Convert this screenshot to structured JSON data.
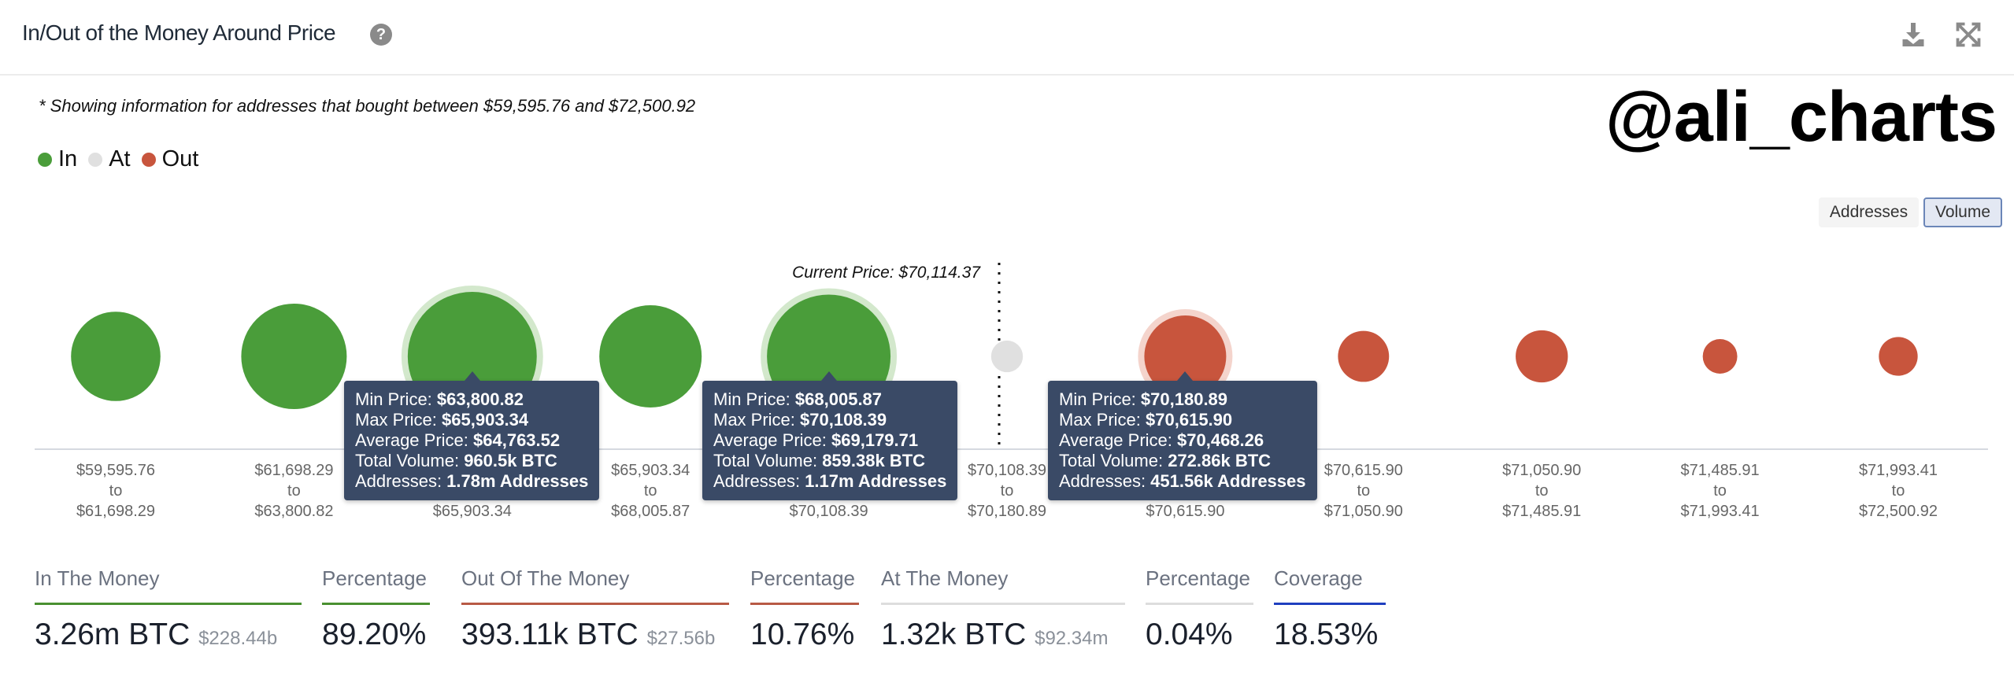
{
  "header": {
    "title": "In/Out of the Money Around Price",
    "help_icon": "question-circle-icon",
    "download_icon": "download-icon",
    "expand_icon": "expand-icon"
  },
  "subtitle": "* Showing information for addresses that bought between $59,595.76 and $72,500.92",
  "brand": "@ali_charts",
  "legend": [
    {
      "label": "In",
      "color": "#4a9d3a"
    },
    {
      "label": "At",
      "color": "#e0e0e0"
    },
    {
      "label": "Out",
      "color": "#c8553d"
    }
  ],
  "toggle": {
    "addresses": "Addresses",
    "volume": "Volume",
    "selected": "Volume"
  },
  "chart_data": {
    "type": "bubble",
    "current_price_label": "Current Price: $70,114.37",
    "current_price": 70114.37,
    "metric": "Volume (BTC, thousands; estimated from bubble size except where tooltip shows)",
    "bins": [
      {
        "from": "$59,595.76",
        "to": "$61,698.29",
        "status": "in",
        "volume_k": 355
      },
      {
        "from": "$61,698.29",
        "to": "$63,800.82",
        "status": "in",
        "volume_k": 565
      },
      {
        "from": "$63,800.82",
        "to": "$65,903.34",
        "status": "in",
        "volume_k": 960.5,
        "highlight": true
      },
      {
        "from": "$65,903.34",
        "to": "$68,005.87",
        "status": "in",
        "volume_k": 520
      },
      {
        "from": "$68,005.87",
        "to": "$70,108.39",
        "status": "in",
        "volume_k": 859.38,
        "highlight": true
      },
      {
        "from": "$70,108.39",
        "to": "$70,180.89",
        "status": "at",
        "volume_k": 1.32
      },
      {
        "from": "$70,180.89",
        "to": "$70,615.90",
        "status": "out",
        "volume_k": 272.86,
        "highlight": true
      },
      {
        "from": "$70,615.90",
        "to": "$71,050.90",
        "status": "out",
        "volume_k": 50
      },
      {
        "from": "$71,050.90",
        "to": "$71,485.91",
        "status": "out",
        "volume_k": 55
      },
      {
        "from": "$71,485.91",
        "to": "$71,993.41",
        "status": "out",
        "volume_k": 4
      },
      {
        "from": "$71,993.41",
        "to": "$72,500.92",
        "status": "out",
        "volume_k": 11
      }
    ],
    "to_word": "to",
    "colors": {
      "in": "#4a9d3a",
      "at": "#e0e0e0",
      "out": "#c8553d",
      "in_halo": "#d3e8cc",
      "out_halo": "#f4d4cc"
    }
  },
  "tooltips": [
    {
      "bin": 2,
      "min_label": "Min Price: ",
      "min": "$63,800.82",
      "max_label": "Max Price: ",
      "max": "$65,903.34",
      "avg_label": "Average Price: ",
      "avg": "$64,763.52",
      "vol_label": "Total Volume: ",
      "vol": "960.5k BTC",
      "addr_label": "Addresses: ",
      "addr": "1.78m Addresses"
    },
    {
      "bin": 4,
      "min_label": "Min Price: ",
      "min": "$68,005.87",
      "max_label": "Max Price: ",
      "max": "$70,108.39",
      "avg_label": "Average Price: ",
      "avg": "$69,179.71",
      "vol_label": "Total Volume: ",
      "vol": "859.38k BTC",
      "addr_label": "Addresses: ",
      "addr": "1.17m Addresses"
    },
    {
      "bin": 6,
      "min_label": "Min Price: ",
      "min": "$70,180.89",
      "max_label": "Max Price: ",
      "max": "$70,615.90",
      "avg_label": "Average Price: ",
      "avg": "$70,468.26",
      "vol_label": "Total Volume: ",
      "vol": "272.86k BTC",
      "addr_label": "Addresses: ",
      "addr": "451.56k Addresses"
    }
  ],
  "stats": [
    {
      "label": "In The Money",
      "value": "3.26m BTC",
      "sub": "$228.44b",
      "color": "#4a9030"
    },
    {
      "label": "Percentage",
      "value": "89.20%",
      "sub": "",
      "color": "#4a9030"
    },
    {
      "label": "Out Of The Money",
      "value": "393.11k BTC",
      "sub": "$27.56b",
      "color": "#b85a45"
    },
    {
      "label": "Percentage",
      "value": "10.76%",
      "sub": "",
      "color": "#b85a45"
    },
    {
      "label": "At The Money",
      "value": "1.32k BTC",
      "sub": "$92.34m",
      "color": "#dddddd"
    },
    {
      "label": "Percentage",
      "value": "0.04%",
      "sub": "",
      "color": "#dddddd"
    },
    {
      "label": "Coverage",
      "value": "18.53%",
      "sub": "",
      "color": "#1f3fbf"
    }
  ]
}
